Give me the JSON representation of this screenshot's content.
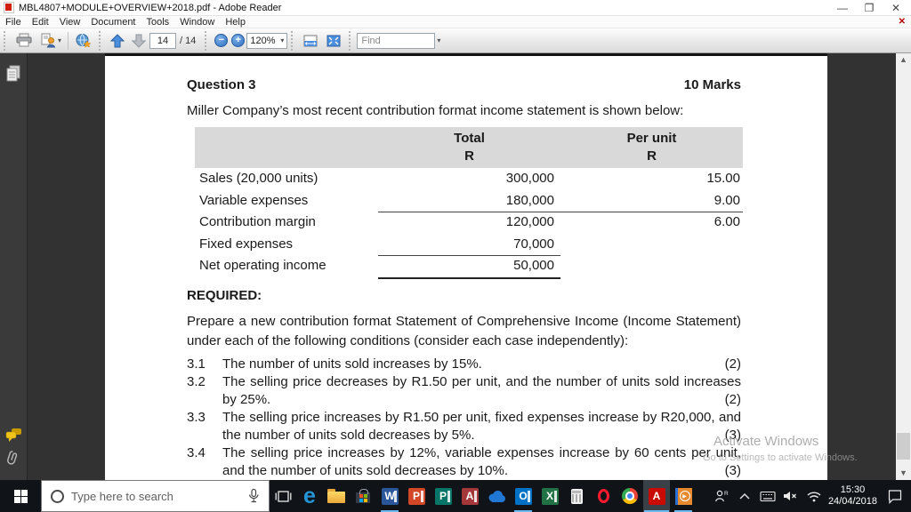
{
  "window": {
    "title": "MBL4807+MODULE+OVERVIEW+2018.pdf - Adobe Reader",
    "controls": {
      "minimize": "—",
      "restore": "❐",
      "close": "✕"
    },
    "app_icon": "pdf-file-icon"
  },
  "menu": {
    "items": [
      "File",
      "Edit",
      "View",
      "Document",
      "Tools",
      "Window",
      "Help"
    ],
    "close_document": "✕"
  },
  "toolbar": {
    "icons": [
      "print-icon",
      "export-icon",
      "share-icon",
      "page-up-icon",
      "page-down-icon",
      "zoom-out-icon",
      "zoom-in-icon",
      "scroll-mode-icon",
      "fit-width-icon"
    ],
    "page_current": "14",
    "page_total": "/ 14",
    "zoom_level": "120%",
    "find_placeholder": "Find",
    "caret": "▾"
  },
  "sidebar": {
    "icons": [
      "pages-panel-icon",
      "comments-icon",
      "attachments-icon"
    ]
  },
  "document": {
    "question_label": "Question 3",
    "marks_label": "10 Marks",
    "intro": "Miller Company’s most recent contribution format income statement is shown below:",
    "table": {
      "col1_header": "Total",
      "col2_header": "Per unit",
      "currency_symbol_1": "R",
      "currency_symbol_2": "R",
      "rows": [
        {
          "label": "Sales (20,000 units)",
          "total": "300,000",
          "per_unit": "15.00"
        },
        {
          "label": "Variable expenses",
          "total": "180,000",
          "per_unit": "9.00"
        },
        {
          "label": "Contribution margin",
          "total": "120,000",
          "per_unit": "6.00"
        },
        {
          "label": "Fixed expenses",
          "total": "70,000",
          "per_unit": ""
        },
        {
          "label": "Net operating income",
          "total": "50,000",
          "per_unit": ""
        }
      ]
    },
    "required_label": "REQUIRED:",
    "instructions": "Prepare a new contribution format Statement of Comprehensive Income (Income Statement) under each of the following conditions (consider each case independently):",
    "items": [
      {
        "number": "3.1",
        "text": "The number of units sold increases by 15%.",
        "marks": "(2)"
      },
      {
        "number": "3.2",
        "text": "The selling price decreases by R1.50 per unit, and the number of units sold increases by 25%.",
        "marks": "(2)"
      },
      {
        "number": "3.3",
        "text": "The selling price increases by R1.50 per unit, fixed expenses increase by R20,000, and the number of units sold decreases by 5%.",
        "marks": "(3)"
      },
      {
        "number": "3.4",
        "text": "The selling price increases by 12%, variable expenses increase by 60 cents per unit, and the number of units sold decreases by 10%.",
        "marks": "(3)"
      }
    ]
  },
  "watermark": {
    "line1": "Activate Windows",
    "line2": "Go to Settings to activate Windows."
  },
  "taskbar": {
    "search_placeholder": "Type here to search",
    "apps": [
      {
        "name": "task-view-icon",
        "glyph": ""
      },
      {
        "name": "edge-icon",
        "glyph": "e"
      },
      {
        "name": "file-explorer-icon",
        "glyph": ""
      },
      {
        "name": "store-icon",
        "glyph": ""
      },
      {
        "name": "word-icon",
        "glyph": "W"
      },
      {
        "name": "powerpoint-icon",
        "glyph": "P"
      },
      {
        "name": "publisher-icon",
        "glyph": "P"
      },
      {
        "name": "access-icon",
        "glyph": "A"
      },
      {
        "name": "onedrive-icon",
        "glyph": ""
      },
      {
        "name": "outlook-icon",
        "glyph": "O"
      },
      {
        "name": "excel-icon",
        "glyph": "X"
      },
      {
        "name": "calculator-icon",
        "glyph": ""
      },
      {
        "name": "opera-icon",
        "glyph": ""
      },
      {
        "name": "chrome-icon",
        "glyph": ""
      },
      {
        "name": "adobe-reader-icon",
        "glyph": "A"
      },
      {
        "name": "media-player-icon",
        "glyph": "▶"
      }
    ],
    "tray_icons": [
      "people-icon",
      "chevron-up-icon",
      "keyboard-icon",
      "volume-muted-icon",
      "network-icon",
      "action-center-icon"
    ],
    "clock_time": "15:30",
    "clock_date": "24/04/2018"
  },
  "colors": {
    "accent_blue": "#2f6fc2",
    "table_header_gray": "#d9d9d9",
    "taskbar_underline": "#6cb8f0",
    "adobe_red": "#c90a00"
  }
}
